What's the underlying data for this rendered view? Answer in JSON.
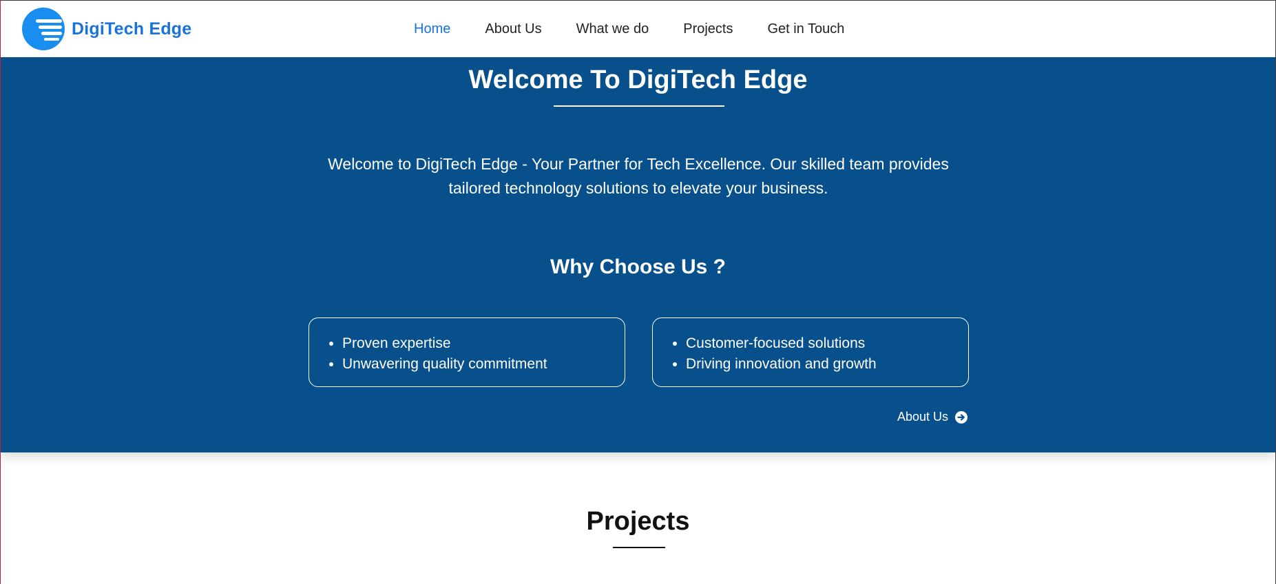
{
  "brand": {
    "name": "DigiTech Edge",
    "accent_color": "#1a73d9",
    "hero_background": "#07508b"
  },
  "nav": {
    "items": [
      {
        "label": "Home",
        "active": true
      },
      {
        "label": "About Us",
        "active": false
      },
      {
        "label": "What we do",
        "active": false
      },
      {
        "label": "Projects",
        "active": false
      },
      {
        "label": "Get in Touch",
        "active": false
      }
    ]
  },
  "hero": {
    "title": "Welcome To DigiTech Edge",
    "intro": "Welcome to DigiTech Edge - Your Partner for Tech Excellence. Our skilled team provides tailored technology solutions to elevate your business.",
    "why_title": "Why Choose Us ?",
    "cards": [
      {
        "items": [
          "Proven expertise",
          "Unwavering quality commitment"
        ]
      },
      {
        "items": [
          "Customer-focused solutions",
          "Driving innovation and growth"
        ]
      }
    ],
    "about_link": {
      "label": "About Us",
      "icon": "arrow-circle-right-icon"
    }
  },
  "projects": {
    "title": "Projects"
  }
}
